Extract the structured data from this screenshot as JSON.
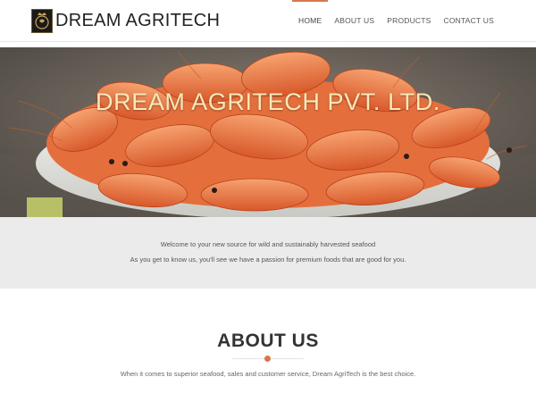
{
  "header": {
    "brand": "DREAM AGRITECH",
    "nav": [
      {
        "label": "HOME",
        "active": true
      },
      {
        "label": "ABOUT US",
        "active": false
      },
      {
        "label": "PRODUCTS",
        "active": false
      },
      {
        "label": "CONTACT US",
        "active": false
      }
    ]
  },
  "hero": {
    "title": "DREAM AGRITECH PVT. LTD."
  },
  "welcome": {
    "line1": "Welcome to your new source for wild and sustainably harvested seafood",
    "line2": "As you get to know us, you'll see we have a passion for premium foods that are good for you."
  },
  "about": {
    "title": "ABOUT US",
    "text": "When it comes to superior seafood, sales and customer service, Dream AgriTech is the best choice."
  },
  "colors": {
    "accent": "#d9784a",
    "hero_title": "#f7e9b8",
    "band": "#ebebeb"
  }
}
